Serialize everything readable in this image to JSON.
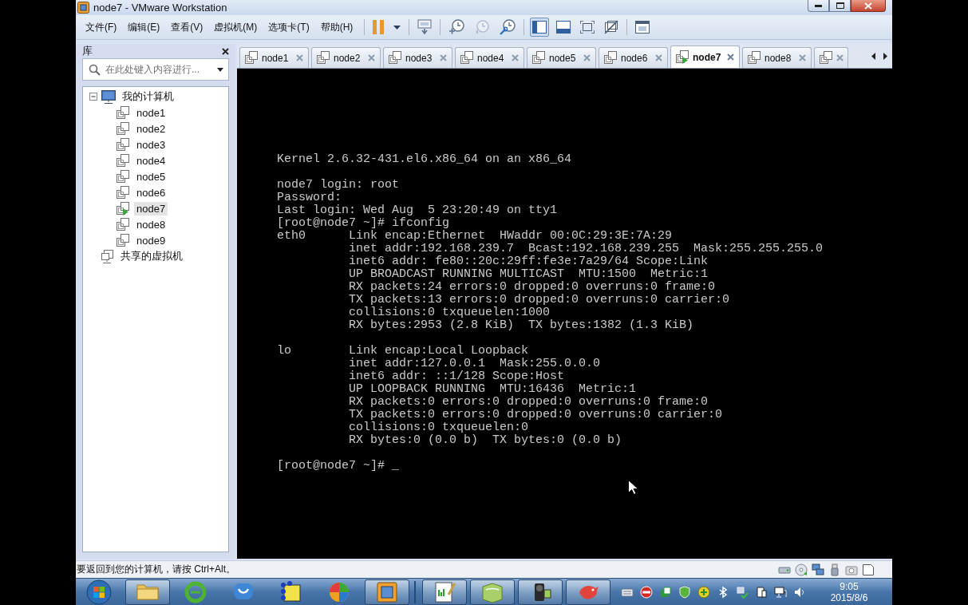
{
  "window": {
    "title": "node7 - VMware Workstation"
  },
  "menu": [
    "文件(F)",
    "编辑(E)",
    "查看(V)",
    "虚拟机(M)",
    "选项卡(T)",
    "帮助(H)"
  ],
  "toolbar": [
    [
      {
        "pressed": false,
        "disabled": false
      }
    ],
    [
      {
        "pressed": false,
        "disabled": false
      }
    ],
    [
      {
        "pressed": false,
        "disabled": false
      },
      {
        "pressed": false,
        "disabled": true
      },
      {
        "pressed": false,
        "disabled": false
      }
    ],
    [
      {
        "pressed": true,
        "disabled": false
      },
      {
        "pressed": false,
        "disabled": false
      },
      {
        "pressed": false,
        "disabled": false
      },
      {
        "pressed": false,
        "disabled": false
      }
    ],
    [
      {
        "pressed": false,
        "disabled": false
      }
    ]
  ],
  "library": {
    "title": "库",
    "search": {
      "placeholder": "在此处键入内容进行..."
    },
    "tree": [
      {
        "kind": "computer",
        "label": "我的计算机",
        "expanded": true,
        "selected": false,
        "children": [
          {
            "kind": "vm",
            "label": "node1",
            "running": false,
            "selected": false
          },
          {
            "kind": "vm",
            "label": "node2",
            "running": false,
            "selected": false
          },
          {
            "kind": "vm",
            "label": "node3",
            "running": false,
            "selected": false
          },
          {
            "kind": "vm",
            "label": "node4",
            "running": false,
            "selected": false
          },
          {
            "kind": "vm",
            "label": "node5",
            "running": false,
            "selected": false
          },
          {
            "kind": "vm",
            "label": "node6",
            "running": false,
            "selected": false
          },
          {
            "kind": "vm",
            "label": "node7",
            "running": true,
            "selected": true
          },
          {
            "kind": "vm",
            "label": "node8",
            "running": false,
            "selected": false
          },
          {
            "kind": "vm",
            "label": "node9",
            "running": false,
            "selected": false
          }
        ]
      },
      {
        "kind": "shared",
        "label": "共享的虚拟机",
        "selected": false
      }
    ]
  },
  "tabs": [
    {
      "label": "node1",
      "running": false,
      "selected": false
    },
    {
      "label": "node2",
      "running": false,
      "selected": false
    },
    {
      "label": "node3",
      "running": false,
      "selected": false
    },
    {
      "label": "node4",
      "running": false,
      "selected": false
    },
    {
      "label": "node5",
      "running": false,
      "selected": false
    },
    {
      "label": "node6",
      "running": false,
      "selected": false
    },
    {
      "label": "node7",
      "running": true,
      "selected": true
    },
    {
      "label": "node8",
      "running": false,
      "selected": false
    },
    {
      "running": false,
      "selected": false
    }
  ],
  "terminal": {
    "banner": "Kernel 2.6.32-431.el6.x86_64 on an x86_64",
    "session": [
      "node7 login: root",
      "Password:",
      "Last login: Wed Aug  5 23:20:49 on tty1",
      "[root@node7 ~]# ifconfig"
    ],
    "interfaces": [
      {
        "name": "eth0",
        "lines": [
          "Link encap:Ethernet  HWaddr 00:0C:29:3E:7A:29",
          "inet addr:192.168.239.7  Bcast:192.168.239.255  Mask:255.255.255.0",
          "inet6 addr: fe80::20c:29ff:fe3e:7a29/64 Scope:Link",
          "UP BROADCAST RUNNING MULTICAST  MTU:1500  Metric:1",
          "RX packets:24 errors:0 dropped:0 overruns:0 frame:0",
          "TX packets:13 errors:0 dropped:0 overruns:0 carrier:0",
          "collisions:0 txqueuelen:1000",
          "RX bytes:2953 (2.8 KiB)  TX bytes:1382 (1.3 KiB)"
        ]
      },
      {
        "name": "lo",
        "lines": [
          "Link encap:Local Loopback",
          "inet addr:127.0.0.1  Mask:255.0.0.0",
          "inet6 addr: ::1/128 Scope:Host",
          "UP LOOPBACK RUNNING  MTU:16436  Metric:1",
          "RX packets:0 errors:0 dropped:0 overruns:0 frame:0",
          "TX packets:0 errors:0 dropped:0 overruns:0 carrier:0",
          "collisions:0 txqueuelen:0",
          "RX bytes:0 (0.0 b)  TX bytes:0 (0.0 b)"
        ]
      }
    ],
    "prompt": "[root@node7 ~]#",
    "cursor": "_"
  },
  "status_bar": {
    "message": "要返回到您的计算机，请按 Ctrl+Alt。"
  },
  "taskbar": {
    "apps": [
      {
        "running": true
      },
      {
        "running": false
      },
      {
        "running": false
      },
      {
        "running": false
      },
      {
        "running": false
      },
      {
        "running": true
      },
      {
        "running": true
      },
      {
        "running": true
      },
      {
        "running": true
      },
      {
        "running": true
      }
    ],
    "clock": {
      "time": "9:05",
      "date": "2015/8/6"
    }
  }
}
